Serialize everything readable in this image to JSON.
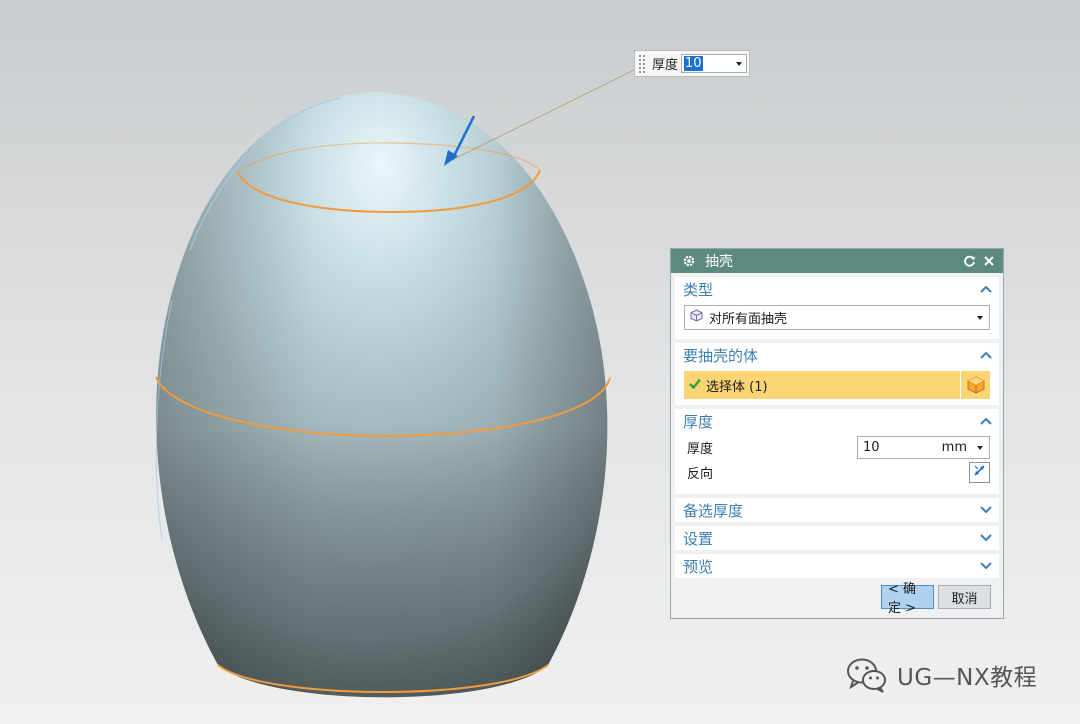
{
  "floating_input": {
    "label": "厚度",
    "value": "10"
  },
  "dialog": {
    "title": "抽壳",
    "sections": {
      "type": {
        "header": "类型",
        "selected": "对所有面抽壳"
      },
      "body": {
        "header": "要抽壳的体",
        "select_label": "选择体 (1)"
      },
      "thickness": {
        "header": "厚度",
        "thickness_label": "厚度",
        "thickness_value": "10",
        "thickness_unit": "mm",
        "reverse_label": "反向"
      },
      "alt_thickness": {
        "header": "备选厚度"
      },
      "settings": {
        "header": "设置"
      },
      "preview": {
        "header": "预览"
      }
    },
    "ok_label": "< 确定 >",
    "cancel_label": "取消"
  },
  "watermark": {
    "text": "UG—NX教程"
  },
  "colors": {
    "title_bar": "#5c8a80",
    "section_header": "#3d7fb3",
    "selection_highlight": "#fbd574",
    "edge_highlight": "#f39a3e",
    "ok_button": "#aed2f0"
  },
  "icons": {
    "settings": "gear-icon",
    "reset": "reset-icon",
    "close": "close-icon",
    "type": "shell-all-faces-icon",
    "check": "check-icon",
    "body": "solid-body-icon",
    "reverse": "reverse-direction-icon",
    "expand": "chevron-up-icon",
    "collapse": "chevron-down-icon",
    "wechat": "wechat-logo"
  }
}
